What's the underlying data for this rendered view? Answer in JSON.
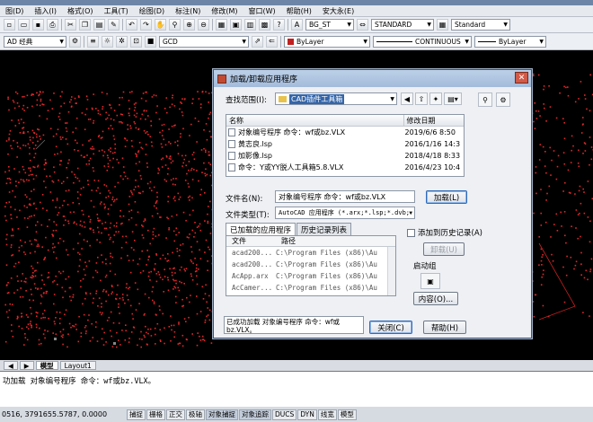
{
  "menubar": {
    "items": [
      "图(D)",
      "插入(I)",
      "格式(O)",
      "工具(T)",
      "绘图(D)",
      "标注(N)",
      "修改(M)",
      "窗口(W)",
      "帮助(H)",
      "安大永(E)"
    ]
  },
  "toolbar1": {
    "layer_combo": "BG_ST",
    "text_style": "STANDARD",
    "dim_style": "Standard"
  },
  "toolbar2": {
    "workspace": "AD 经典",
    "color_combo": "ByLayer",
    "linetype_combo": "CONTINUOUS",
    "lineweight_combo": "ByLayer",
    "small_label": "GCD"
  },
  "dialog": {
    "title": "加载/卸载应用程序",
    "close_glyph": "✕",
    "lookin_label": "查找范围(I):",
    "lookin_value": "CAD插件工具箱",
    "columns": {
      "name": "名称",
      "date": "修改日期"
    },
    "files": [
      {
        "name": "对象编号程序 命令：wf或bz.VLX",
        "date": "2019/6/6 8:50"
      },
      {
        "name": "黄志良.lsp",
        "date": "2016/1/16 14:3"
      },
      {
        "name": "加影像.lsp",
        "date": "2018/4/18 8:33"
      },
      {
        "name": "命令：Y或YY脱人工具箱5.8.VLX",
        "date": "2016/4/23 10:4"
      }
    ],
    "filename_label": "文件名(N):",
    "filename_value": "对象编号程序 命令：wf或bz.VLX",
    "filetype_label": "文件类型(T):",
    "filetype_value": "AutoCAD 应用程序 (*.arx;*.lsp;*.dvb;",
    "load_button": "加载(L)",
    "tabs": [
      "已加载的应用程序",
      "历史记录列表"
    ],
    "loaded": {
      "columns": {
        "file": "文件",
        "path": "路径"
      },
      "rows": [
        {
          "file": "acad200...",
          "path": "C:\\Program Files (x86)\\Au"
        },
        {
          "file": "acad200...",
          "path": "C:\\Program Files (x86)\\Au"
        },
        {
          "file": "AcApp.arx",
          "path": "C:\\Program Files (x86)\\Au"
        },
        {
          "file": "AcCamer...",
          "path": "C:\\Program Files (x86)\\Au"
        }
      ]
    },
    "add_history_label": "添加到历史记录(A)",
    "unload_button": "卸载(U)",
    "startup_label": "启动组",
    "contents_button": "内容(O)...",
    "status_message": "已成功加载 对象编号程序 命令：wf或bz.VLX。",
    "close_button": "关闭(C)",
    "help_button": "帮助(H)"
  },
  "layout_tabs": [
    "模型",
    "Layout1"
  ],
  "command_line": "功加载 对象编号程序 命令：wf或bz.VLX。",
  "status_bar": {
    "coords": "0516, 3791655.5787, 0.0000",
    "buttons": [
      "捕捉",
      "栅格",
      "正交",
      "极轴",
      "对象捕捉",
      "对象追踪",
      "DUCS",
      "DYN",
      "线宽",
      "模型"
    ],
    "active": [
      "对象捕捉",
      "对象追踪"
    ]
  },
  "colors": {
    "dialog_title_bg": "#a9c0de",
    "points": "#e0282a",
    "canvas": "#000000"
  }
}
